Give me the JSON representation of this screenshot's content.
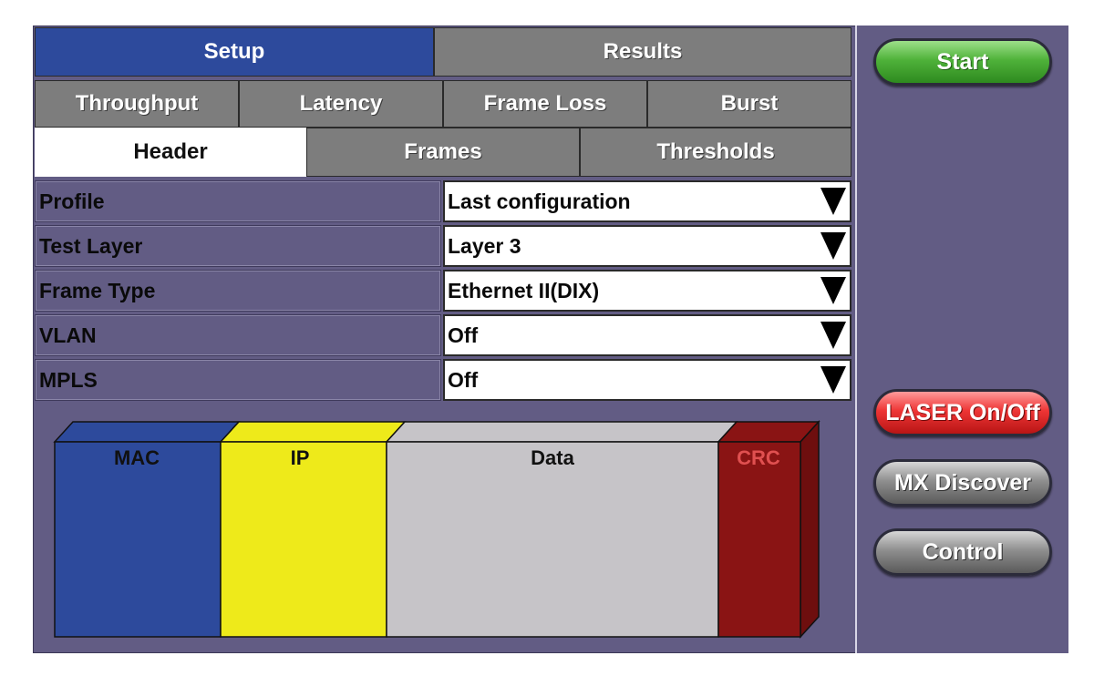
{
  "tabs_main": [
    {
      "label": "Setup",
      "active": true
    },
    {
      "label": "Results",
      "active": false
    }
  ],
  "tabs_test": [
    {
      "label": "Throughput"
    },
    {
      "label": "Latency"
    },
    {
      "label": "Frame Loss"
    },
    {
      "label": "Burst"
    }
  ],
  "tabs_sub": [
    {
      "label": "Header",
      "active": true
    },
    {
      "label": "Frames",
      "active": false
    },
    {
      "label": "Thresholds",
      "active": false
    }
  ],
  "fields": [
    {
      "label": "Profile",
      "value": "Last configuration"
    },
    {
      "label": "Test Layer",
      "value": "Layer 3"
    },
    {
      "label": "Frame Type",
      "value": "Ethernet II(DIX)"
    },
    {
      "label": "VLAN",
      "value": "Off"
    },
    {
      "label": "MPLS",
      "value": "Off"
    }
  ],
  "frame_diagram": [
    {
      "label": "MAC",
      "color": "#2d4a9c"
    },
    {
      "label": "IP",
      "color": "#eeea1a"
    },
    {
      "label": "Data",
      "color": "#c6c4c8"
    },
    {
      "label": "CRC",
      "color": "#8a1414"
    }
  ],
  "sidebar": {
    "start": "Start",
    "laser": "LASER On/Off",
    "mx_discover": "MX Discover",
    "control": "Control"
  },
  "colors": {
    "panel": "#625c84",
    "tab_active": "#2d4a9c",
    "tab_inactive": "#7d7d7d"
  }
}
